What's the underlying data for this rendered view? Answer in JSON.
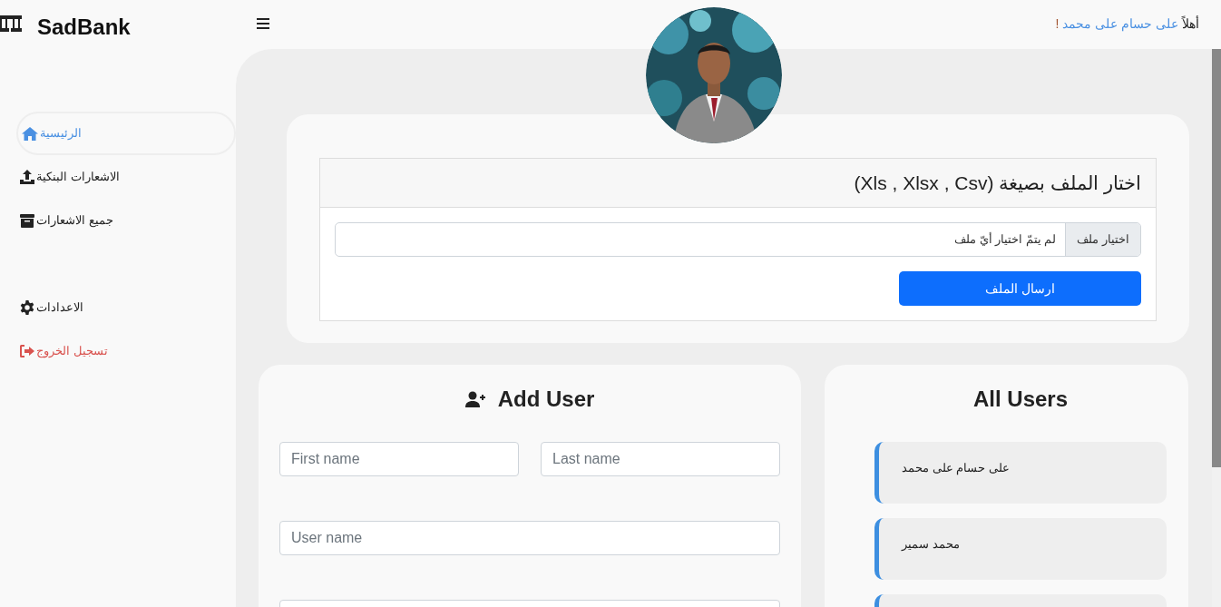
{
  "brand": {
    "name": "SadBank"
  },
  "greeting": {
    "prefix": "أهلاً",
    "user": "على حسام على محمد",
    "suffix": "!"
  },
  "sidebar": {
    "items": [
      {
        "label": "الرئيسية",
        "kind": "home",
        "selected": true
      },
      {
        "label": "الاشعارات البنكية",
        "kind": "upload",
        "selected": false
      },
      {
        "label": "جميع الاشعارات",
        "kind": "archive",
        "selected": false
      }
    ],
    "lower_items": [
      {
        "label": "الاعدادات",
        "kind": "settings",
        "selected": false
      },
      {
        "label": "تسجيل الخروج",
        "kind": "logout",
        "selected": false
      }
    ]
  },
  "upload": {
    "title": "اختار الملف بصيغة (Xls , Xlsx , Csv)",
    "choose_button": "اختيار ملف",
    "no_file": "لم يتمّ اختيار أيّ ملف",
    "submit": "ارسال الملف"
  },
  "add_user": {
    "title": "Add User",
    "fields": [
      {
        "kind": "half",
        "placeholder": "First name"
      },
      {
        "kind": "half",
        "placeholder": "Last name"
      },
      {
        "kind": "full",
        "placeholder": "User name"
      },
      {
        "kind": "full"
      }
    ]
  },
  "all_users": {
    "title": "All Users",
    "users": [
      {
        "kind": "entry",
        "name": "على حسام على محمد"
      },
      {
        "kind": "entry",
        "name": "محمد سمير"
      },
      {
        "kind": "entry"
      }
    ]
  }
}
